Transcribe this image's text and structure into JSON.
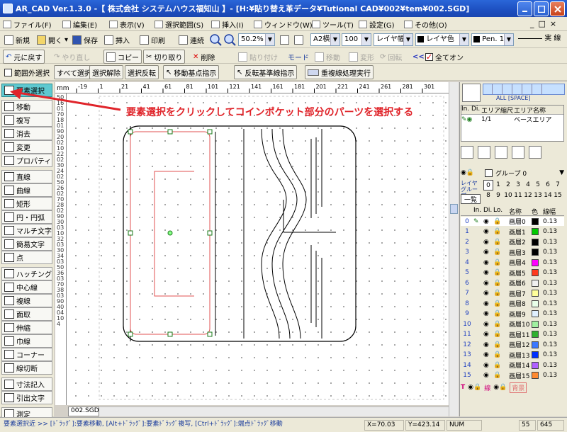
{
  "window": {
    "title": "AR_CAD Ver.1.3.0 -【 株式会社 システムハウス福知山 】- [H:¥貼り替え革データ¥Tutional CAD¥002¥tem¥002.SGD]"
  },
  "menu": [
    "ファイル(F)",
    "編集(E)",
    "表示(V)",
    "選択範囲(S)",
    "挿入(I)",
    "ウィンドウ(W)",
    "ツール(T)",
    "設定(G)",
    "その他(O)"
  ],
  "toolbar1": {
    "new": "新規",
    "open": "開く",
    "save": "保存",
    "insert": "挿入",
    "print": "印刷",
    "continuous": "連続",
    "zoom": "50.2%",
    "paper": "A2横",
    "scale": "100",
    "line_width": "レイヤ幅",
    "color": "レイヤ色",
    "pen": "Pen. 1",
    "linetype": "実 線"
  },
  "toolbar2": {
    "undo": "元に戻す",
    "redo": "やり直し",
    "copy": "コピー",
    "cut": "切り取り",
    "delete": "削除",
    "paste": "貼り付け",
    "mode": "モード",
    "move": "移動",
    "transform": "変形",
    "rotate": "回転",
    "all_on": "全てオン"
  },
  "toolbar3": {
    "out_of_range": "範囲外選択",
    "select_all": "すべて選択",
    "deselect": "選択解除",
    "invert": "選択反転",
    "move_base": "移動基点指示",
    "flip_base": "反転基準線指示",
    "overlap": "重複線処理実行"
  },
  "left_tools": [
    "要素選択",
    "移動",
    "複写",
    "消去",
    "変更",
    "プロパティ",
    "直線",
    "曲線",
    "矩形",
    "円・円弧",
    "マルチ文字",
    "簡易文字",
    "点",
    "ハッチング",
    "中心線",
    "複線",
    "面取",
    "伸縮",
    "巾線",
    "コーナー",
    "線切断",
    "寸法記入",
    "引出文字",
    "測定"
  ],
  "ruler": {
    "unit": "mm",
    "ticks": [
      "-19",
      "1",
      "21",
      "41",
      "61",
      "81",
      "101",
      "121",
      "141",
      "161",
      "181",
      "201",
      "221",
      "241",
      "261",
      "281",
      "301"
    ]
  },
  "vruler_text": "501601701801902002102202302402502602702802903003103203303403503603703803904004104",
  "annotation": "要素選択をクリックしてコインポケット部分のパーツを選択する",
  "document_tab": "002.SGD",
  "right": {
    "snap_label": "ALL [SPACE]",
    "area_headers": [
      "In.",
      "Di.",
      "エリア縮尺",
      "エリア名称"
    ],
    "area_row": {
      "scale": "1/1",
      "name": "ベースエリア"
    },
    "group": "グループ 0",
    "layer_group_label": "レイヤグループ",
    "list_button": "一覧",
    "layer_group_numbers": [
      "0",
      "1",
      "2",
      "3",
      "4",
      "5",
      "6",
      "7",
      "8",
      "9",
      "10",
      "11",
      "12",
      "13",
      "14",
      "15"
    ],
    "layer_headers": [
      "In.",
      "Di.",
      "Lo.",
      "名称",
      "色",
      "線幅"
    ],
    "layers": [
      {
        "n": "0",
        "name": "画層0",
        "color": "#000000",
        "w": "0.13"
      },
      {
        "n": "1",
        "name": "画層1",
        "color": "#00c800",
        "w": "0.13"
      },
      {
        "n": "2",
        "name": "画層2",
        "color": "#000000",
        "w": "0.13"
      },
      {
        "n": "3",
        "name": "画層3",
        "color": "#000000",
        "w": "0.13"
      },
      {
        "n": "4",
        "name": "画層4",
        "color": "#ff00ff",
        "w": "0.13"
      },
      {
        "n": "5",
        "name": "画層5",
        "color": "#ff3a1e",
        "w": "0.13"
      },
      {
        "n": "6",
        "name": "画層6",
        "color": "#f0f0f0",
        "w": "0.13"
      },
      {
        "n": "7",
        "name": "画層7",
        "color": "#ffff9a",
        "w": "0.13"
      },
      {
        "n": "8",
        "name": "画層8",
        "color": "#e8ffe8",
        "w": "0.13"
      },
      {
        "n": "9",
        "name": "画層9",
        "color": "#e0f0ff",
        "w": "0.13"
      },
      {
        "n": "10",
        "name": "画層10",
        "color": "#a0f0a0",
        "w": "0.13"
      },
      {
        "n": "11",
        "name": "画層11",
        "color": "#30b030",
        "w": "0.13"
      },
      {
        "n": "12",
        "name": "画層12",
        "color": "#3c78ff",
        "w": "0.13"
      },
      {
        "n": "13",
        "name": "画層13",
        "color": "#0030ff",
        "w": "0.13"
      },
      {
        "n": "14",
        "name": "画層14",
        "color": "#b060ff",
        "w": "0.13"
      },
      {
        "n": "15",
        "name": "画層15",
        "color": "#ff8a30",
        "w": "0.13"
      }
    ],
    "bottom": {
      "t": "T",
      "line": "線",
      "background": "背景"
    }
  },
  "status": {
    "message": "要素選択近 >> [ﾄﾞﾗｯｸﾞ]:要素移動, [Alt+ﾄﾞﾗｯｸﾞ]:要素ﾄﾞﾗｯｸﾞ複写, [Ctrl+ﾄﾞﾗｯｸﾞ]:端点ﾄﾞﾗｯｸﾞ移動",
    "x": "X=70.03",
    "y": "Y=423.14",
    "num": "NUM",
    "v1": "55",
    "v2": "645"
  }
}
